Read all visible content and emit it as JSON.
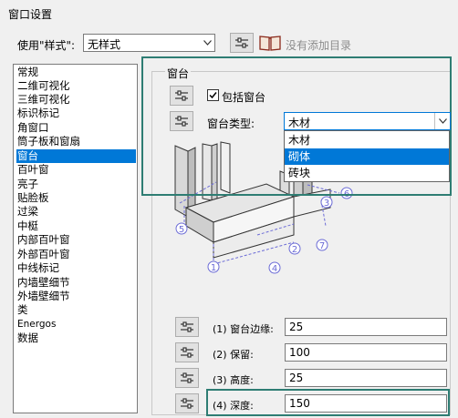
{
  "window": {
    "title": "窗口设置"
  },
  "toolbar": {
    "style_label": "使用\"样式\":",
    "style_value": "无样式",
    "no_catalog_label": "没有添加目录"
  },
  "categories": [
    {
      "label": "常规"
    },
    {
      "label": "二维可视化"
    },
    {
      "label": "三维可视化"
    },
    {
      "label": "标识标记"
    },
    {
      "label": "角窗口"
    },
    {
      "label": "筒子板和窗扇"
    },
    {
      "label": "窗台"
    },
    {
      "label": "百叶窗"
    },
    {
      "label": "亮子"
    },
    {
      "label": "贴脸板"
    },
    {
      "label": "过梁"
    },
    {
      "label": "中梃"
    },
    {
      "label": "内部百叶窗"
    },
    {
      "label": "外部百叶窗"
    },
    {
      "label": "中线标记"
    },
    {
      "label": "内墙壁细节"
    },
    {
      "label": "外墙壁细节"
    },
    {
      "label": "类"
    },
    {
      "label": "Energos"
    },
    {
      "label": "数据"
    }
  ],
  "selected_category": "窗台",
  "sill": {
    "group_title": "窗台",
    "include_label": "包括窗台",
    "include_checked": true,
    "type_label": "窗台类型:",
    "type_value": "木材",
    "type_options": [
      {
        "label": "木材",
        "selected": false
      },
      {
        "label": "砌体",
        "selected": true
      },
      {
        "label": "砖块",
        "selected": false
      }
    ],
    "diagram_labels": [
      "1",
      "2",
      "3",
      "4",
      "5",
      "6",
      "7"
    ],
    "fields": [
      {
        "label": "(1) 窗台边缘:",
        "value": "25"
      },
      {
        "label": "(2) 保留:",
        "value": "100"
      },
      {
        "label": "(3) 高度:",
        "value": "25"
      },
      {
        "label": "(4) 深度:",
        "value": "150"
      }
    ]
  },
  "colors": {
    "highlight": "#2e7d73",
    "selection": "#0078d7",
    "diagram": "#6b6bd6"
  }
}
